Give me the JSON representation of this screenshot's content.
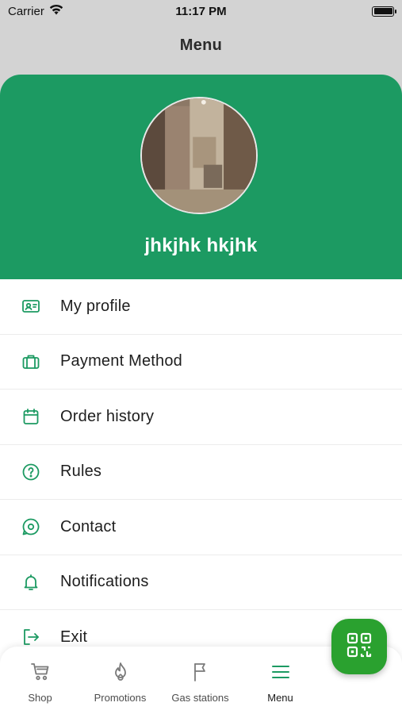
{
  "status_bar": {
    "carrier": "Carrier",
    "time": "11:17 PM"
  },
  "nav": {
    "title": "Menu"
  },
  "profile": {
    "name": "jhkjhk hkjhk"
  },
  "menu": {
    "items": [
      {
        "label": "My profile",
        "icon": "id-card-icon"
      },
      {
        "label": "Payment Method",
        "icon": "briefcase-icon"
      },
      {
        "label": "Order history",
        "icon": "calendar-icon"
      },
      {
        "label": "Rules",
        "icon": "question-circle-icon"
      },
      {
        "label": "Contact",
        "icon": "chat-bubble-icon"
      },
      {
        "label": "Notifications",
        "icon": "bell-icon"
      },
      {
        "label": "Exit",
        "icon": "logout-icon"
      }
    ]
  },
  "tabs": [
    {
      "label": "Shop",
      "icon": "cart-icon"
    },
    {
      "label": "Promotions",
      "icon": "flame-icon"
    },
    {
      "label": "Gas stations",
      "icon": "flag-icon"
    },
    {
      "label": "Menu",
      "icon": "hamburger-icon",
      "active": true
    }
  ],
  "colors": {
    "accent": "#1c9a62",
    "qr_button": "#2aa12f",
    "icon_green": "#1c9a62"
  }
}
